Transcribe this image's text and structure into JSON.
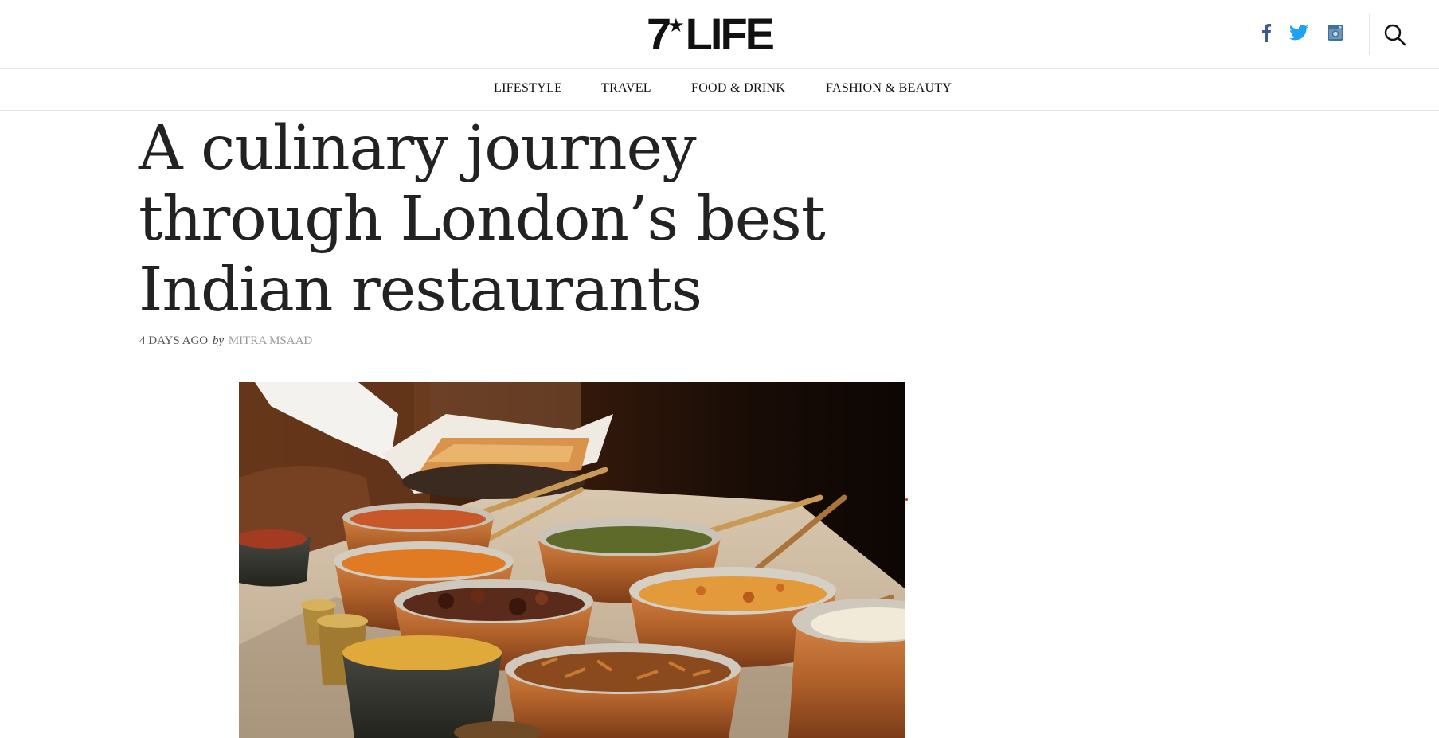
{
  "site": {
    "logo_number": "7",
    "logo_star": "★",
    "logo_word": "LIFE"
  },
  "header": {
    "social": [
      {
        "name": "facebook-icon",
        "color": "#3b5998"
      },
      {
        "name": "twitter-icon",
        "color": "#1da1f2"
      },
      {
        "name": "instagram-icon",
        "color": "#3f729b"
      }
    ],
    "search_icon": "search-icon"
  },
  "nav": {
    "items": [
      {
        "label": "LIFESTYLE"
      },
      {
        "label": "TRAVEL"
      },
      {
        "label": "FOOD & DRINK"
      },
      {
        "label": "FASHION & BEAUTY"
      }
    ]
  },
  "article": {
    "title_lines": [
      "A culinary journey",
      "through London’s best",
      "Indian restaurants"
    ],
    "date": "4 DAYS AGO",
    "by": "by",
    "author": "MITRA MSAAD"
  },
  "colors": {
    "text": "#222222",
    "muted": "#9a9a9a",
    "border": "#e4e4e4",
    "copper": "#b5652c",
    "curry_orange": "#e07a23",
    "dal_yellow": "#d9a634"
  }
}
